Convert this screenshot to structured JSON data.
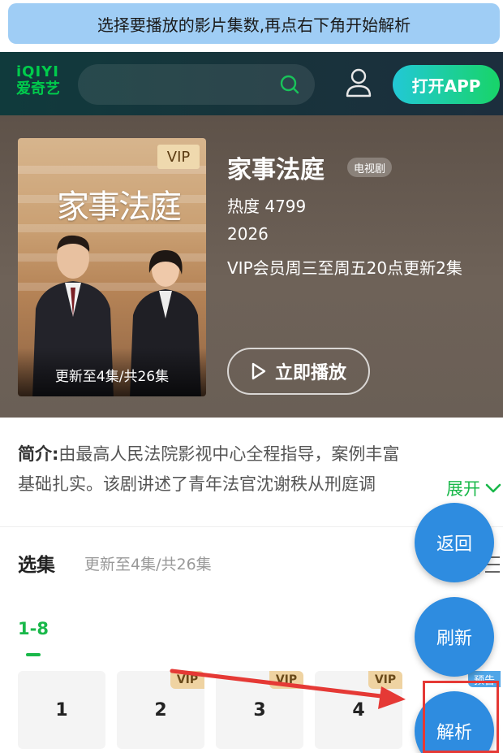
{
  "hint_banner": "选择要播放的影片集数,再点右下角开始解析",
  "header": {
    "logo_line1": "iQIYI",
    "logo_line2": "爱奇艺",
    "open_app": "打开APP",
    "brand_color": "#00cc4c"
  },
  "show": {
    "title": "家事法庭",
    "type_badge": "电视剧",
    "heat": "热度 4799",
    "year": "2026",
    "schedule": "VIP会员周三至周五20点更新2集",
    "play_button": "立即播放",
    "poster_vip": "VIP",
    "poster_title": "家事法庭",
    "poster_caption": "更新至4集/共26集"
  },
  "intro": {
    "label": "简介:",
    "line1": "由最高人民法院影视中心全程指导，案例丰富",
    "line2": "基础扎实。该剧讲述了青年法官沈谢秩从刑庭调",
    "expand": "展开"
  },
  "episodes": {
    "title": "选集",
    "subtitle": "更新至4集/共26集",
    "range_tab": "1-8",
    "items": [
      {
        "number": "1",
        "badge": ""
      },
      {
        "number": "2",
        "badge": "VIP"
      },
      {
        "number": "3",
        "badge": "VIP"
      },
      {
        "number": "4",
        "badge": "VIP"
      }
    ],
    "preview_badge": "预告"
  },
  "fab": {
    "back": "返回",
    "refresh": "刷新",
    "parse": "解析",
    "color": "#2e8ce0"
  },
  "accent_green": "#19b84a",
  "annotation_color": "#e53935"
}
